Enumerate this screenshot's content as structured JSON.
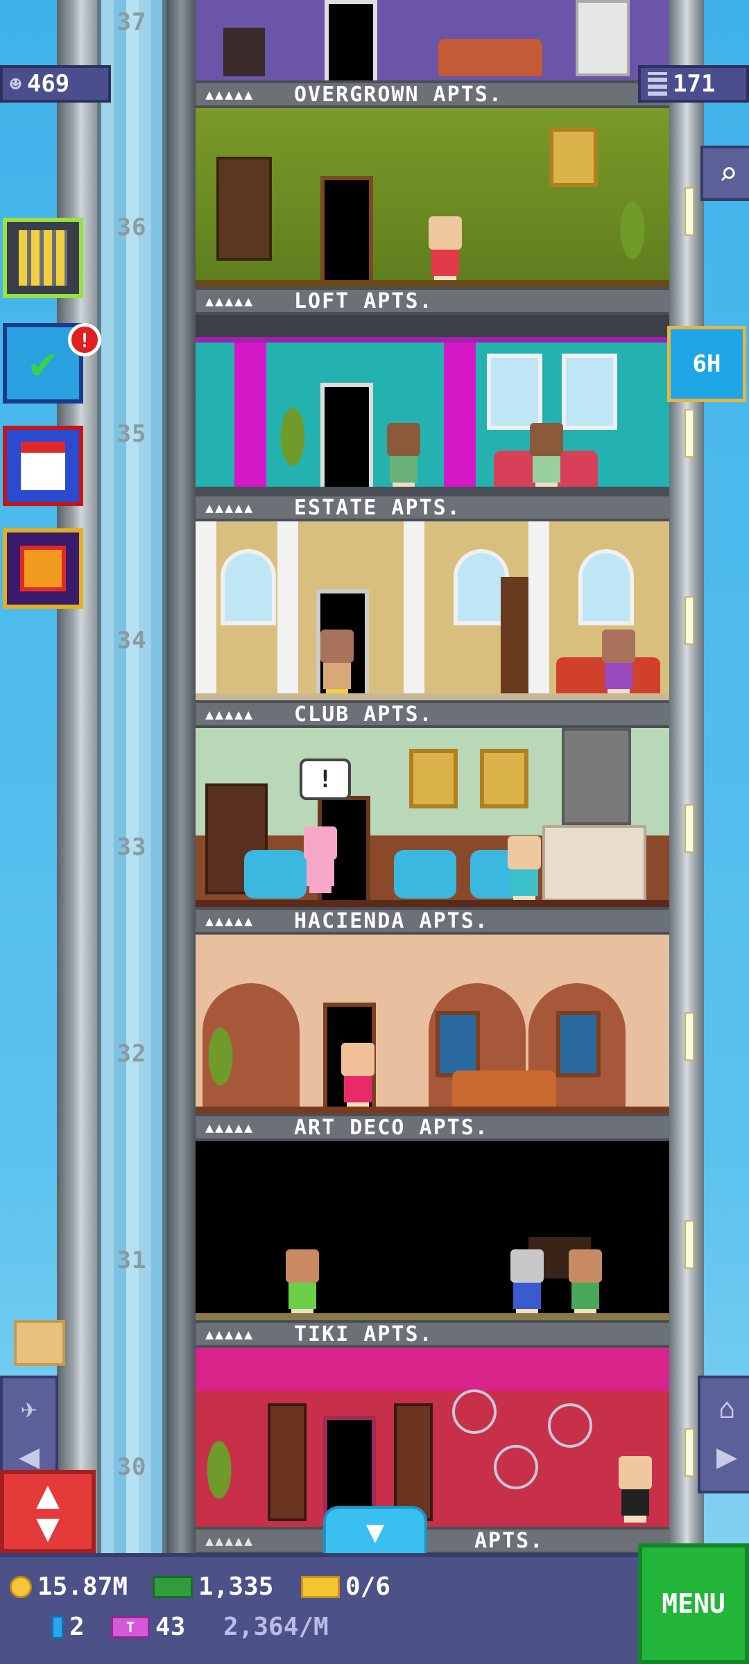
{
  "hud": {
    "population": "469",
    "floors": "171",
    "timer": "6H",
    "notification_badge": "!"
  },
  "shaft": {
    "floor_numbers": [
      "37",
      "36",
      "35",
      "34",
      "33",
      "32",
      "31",
      "30"
    ]
  },
  "floors": [
    {
      "name": "OVERGROWN APTS.",
      "stars": "▲▲▲▲▲"
    },
    {
      "name": "LOFT APTS.",
      "stars": "▲▲▲▲▲"
    },
    {
      "name": "ESTATE APTS.",
      "stars": "▲▲▲▲▲"
    },
    {
      "name": "CLUB APTS.",
      "stars": "▲▲▲▲▲"
    },
    {
      "name": "HACIENDA APTS.",
      "stars": "▲▲▲▲▲"
    },
    {
      "name": "ART DECO APTS.",
      "stars": "▲▲▲▲▲"
    },
    {
      "name": "TIKI APTS.",
      "stars": "▲▲▲▲▲"
    }
  ],
  "partial_floor": {
    "name_fragment": "APTS."
  },
  "bottom_bar": {
    "coins": "15.87M",
    "bux": "1,335",
    "tickets": "0/6",
    "tokens": "2",
    "tbux": "43",
    "rate": "2,364/M",
    "menu_label": "MENU"
  },
  "speech_bubble": "!",
  "colors": {
    "hud_bg": "#4a4e8c",
    "menu_green": "#23b53a",
    "elevator_red": "#e53a3a",
    "timer_blue": "#1ea6e6"
  }
}
